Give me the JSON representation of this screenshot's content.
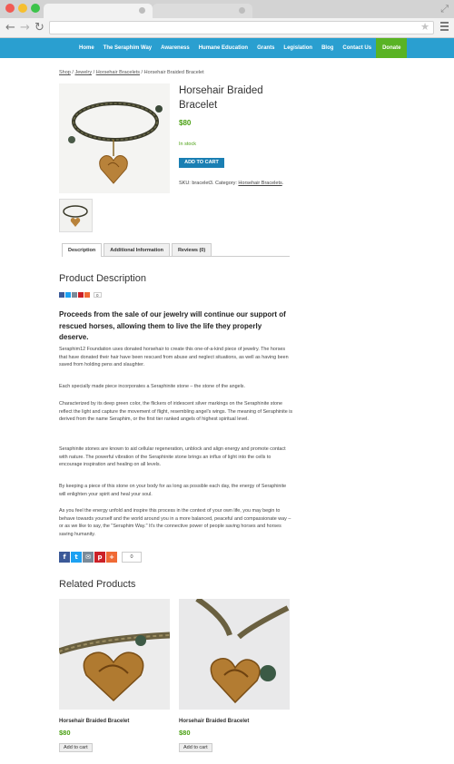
{
  "nav": {
    "items": [
      "Home",
      "The Seraphim Way",
      "Awareness",
      "Humane Education",
      "Grants",
      "Legislation",
      "Blog",
      "Contact Us"
    ],
    "donate": "Donate"
  },
  "breadcrumb": {
    "shop": "Shop",
    "sep1": " / ",
    "jewelry": "Jewelry",
    "sep2": " / ",
    "bracelets": "Horsehair Bracelets",
    "sep3": " / ",
    "current": "Horsehair Braided Bracelet"
  },
  "product": {
    "title": "Horsehair Braided Bracelet",
    "price": "$80",
    "stock": "In stock",
    "add_to_cart": "ADD TO CART",
    "sku_label": "SKU: bracelet3. Category: ",
    "category": "Horsehair Bracelets",
    "category_end": "."
  },
  "tabs": [
    "Description",
    "Additional Information",
    "Reviews (0)"
  ],
  "description": {
    "heading": "Product Description",
    "share_count": "0",
    "lead": "Proceeds from the sale of our jewelry will continue our support of rescued horses, allowing them to live the life they properly deserve.",
    "paragraphs": [
      "Seraphim12 Foundation uses donated horsehair to create this one-of-a-kind piece of jewelry. The horses that have donated their hair have been rescued from abuse and neglect situations, as well as having been saved from holding pens and slaughter.",
      "Each specially made piece incorporates a Seraphinite stone – the stone of the angels.",
      "Characterized by its deep green color, the flickers of iridescent silver markings on the Seraphinite stone reflect the light and capture the movement of flight, resembling angel's wings.  The meaning of Seraphinite is derived from the name Seraphim, or the first tier ranked angels of highest spiritual level.",
      "Seraphinite stones are known to aid cellular regeneration, unblock and align energy and promote contact with nature. The powerful vibration of the Seraphinite stone brings an influx of light into the cells to encourage inspiration and healing on all levels.",
      "By keeping a piece of this stone on your body for as long as possible each day, the energy of Seraphinite will enlighten your spirit and heal your soul.",
      "As you feel the energy unfold and inspire this process in the context of your own life, you may begin to behave towards yourself and the world around you in a more balanced, peaceful and compassionate way – or as we like to say, the \"Seraphim Way.\" It's the connective power of people saving horses and horses saving humanity."
    ],
    "big_share_count": "0"
  },
  "related": {
    "heading": "Related Products",
    "items": [
      {
        "name": "Horsehair Braided Bracelet",
        "price": "$80",
        "button": "Add to cart"
      },
      {
        "name": "Horsehair Braided Bracelet",
        "price": "$80",
        "button": "Add to cart"
      }
    ]
  },
  "colors": {
    "nav_bg": "#2a9fd0",
    "donate_bg": "#59b324",
    "price": "#4aa012",
    "button": "#1a7fb3"
  }
}
